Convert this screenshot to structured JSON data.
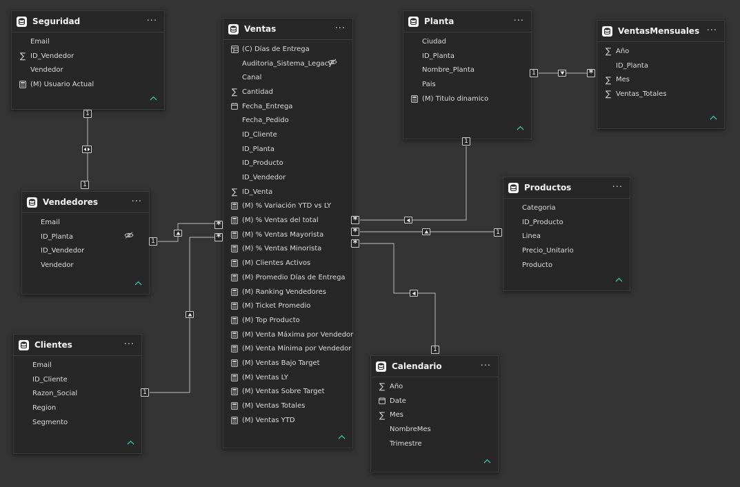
{
  "tables": {
    "seguridad": {
      "title": "Seguridad",
      "fields": [
        {
          "name": "Email",
          "icon": "none"
        },
        {
          "name": "ID_Vendedor",
          "icon": "sigma"
        },
        {
          "name": "Vendedor",
          "icon": "none"
        },
        {
          "name": "(M) Usuario Actual",
          "icon": "calc"
        }
      ]
    },
    "ventas": {
      "title": "Ventas",
      "fields": [
        {
          "name": "(C) Días de Entrega",
          "icon": "calc-col"
        },
        {
          "name": "Auditoria_Sistema_Legacy",
          "icon": "none",
          "hidden": true
        },
        {
          "name": "Canal",
          "icon": "none"
        },
        {
          "name": "Cantidad",
          "icon": "sigma"
        },
        {
          "name": "Fecha_Entrega",
          "icon": "calendar"
        },
        {
          "name": "Fecha_Pedido",
          "icon": "none"
        },
        {
          "name": "ID_Cliente",
          "icon": "none"
        },
        {
          "name": "ID_Planta",
          "icon": "none"
        },
        {
          "name": "ID_Producto",
          "icon": "none"
        },
        {
          "name": "ID_Vendedor",
          "icon": "none"
        },
        {
          "name": "ID_Venta",
          "icon": "sigma"
        },
        {
          "name": "(M) % Variación YTD vs LY",
          "icon": "calc"
        },
        {
          "name": "(M) % Ventas del total",
          "icon": "calc"
        },
        {
          "name": "(M) % Ventas Mayorista",
          "icon": "calc"
        },
        {
          "name": "(M) % Ventas Minorista",
          "icon": "calc"
        },
        {
          "name": "(M) Clientes Activos",
          "icon": "calc"
        },
        {
          "name": "(M) Promedio Días de Entrega",
          "icon": "calc"
        },
        {
          "name": "(M) Ranking Vendedores",
          "icon": "calc"
        },
        {
          "name": "(M) Ticket Promedio",
          "icon": "calc"
        },
        {
          "name": "(M) Top Producto",
          "icon": "calc"
        },
        {
          "name": "(M) Venta Máxima por Vendedor",
          "icon": "calc"
        },
        {
          "name": "(M) Venta Mínima por Vendedor",
          "icon": "calc"
        },
        {
          "name": "(M) Ventas Bajo Target",
          "icon": "calc"
        },
        {
          "name": "(M) Ventas LY",
          "icon": "calc"
        },
        {
          "name": "(M) Ventas Sobre Target",
          "icon": "calc"
        },
        {
          "name": "(M) Ventas Totales",
          "icon": "calc"
        },
        {
          "name": "(M) Ventas YTD",
          "icon": "calc"
        }
      ]
    },
    "planta": {
      "title": "Planta",
      "fields": [
        {
          "name": "Ciudad",
          "icon": "none"
        },
        {
          "name": "ID_Planta",
          "icon": "none"
        },
        {
          "name": "Nombre_Planta",
          "icon": "none"
        },
        {
          "name": "Pais",
          "icon": "none"
        },
        {
          "name": "(M) Titulo dinamico",
          "icon": "calc"
        }
      ]
    },
    "ventasMensuales": {
      "title": "VentasMensuales",
      "fields": [
        {
          "name": "Año",
          "icon": "sigma"
        },
        {
          "name": "ID_Planta",
          "icon": "none"
        },
        {
          "name": "Mes",
          "icon": "sigma"
        },
        {
          "name": "Ventas_Totales",
          "icon": "sigma"
        }
      ]
    },
    "vendedores": {
      "title": "Vendedores",
      "fields": [
        {
          "name": "Email",
          "icon": "none"
        },
        {
          "name": "ID_Planta",
          "icon": "none",
          "hidden": true
        },
        {
          "name": "ID_Vendedor",
          "icon": "none"
        },
        {
          "name": "Vendedor",
          "icon": "none"
        }
      ]
    },
    "productos": {
      "title": "Productos",
      "fields": [
        {
          "name": "Categoria",
          "icon": "none"
        },
        {
          "name": "ID_Producto",
          "icon": "none"
        },
        {
          "name": "Linea",
          "icon": "none"
        },
        {
          "name": "Precio_Unitario",
          "icon": "none"
        },
        {
          "name": "Producto",
          "icon": "none"
        }
      ]
    },
    "clientes": {
      "title": "Clientes",
      "fields": [
        {
          "name": "Email",
          "icon": "none"
        },
        {
          "name": "ID_Cliente",
          "icon": "none"
        },
        {
          "name": "Razon_Social",
          "icon": "none"
        },
        {
          "name": "Region",
          "icon": "none"
        },
        {
          "name": "Segmento",
          "icon": "none"
        }
      ]
    },
    "calendario": {
      "title": "Calendario",
      "fields": [
        {
          "name": "Año",
          "icon": "sigma"
        },
        {
          "name": "Date",
          "icon": "calendar"
        },
        {
          "name": "Mes",
          "icon": "sigma"
        },
        {
          "name": "NombreMes",
          "icon": "none"
        },
        {
          "name": "Trimestre",
          "icon": "none"
        }
      ]
    }
  },
  "cardinality": {
    "one": "1",
    "many": "*"
  },
  "more_label": "···",
  "colors": {
    "canvas": "#343434",
    "card": "#272727",
    "accent": "#3dc3a4",
    "line": "#bdbdbd"
  }
}
